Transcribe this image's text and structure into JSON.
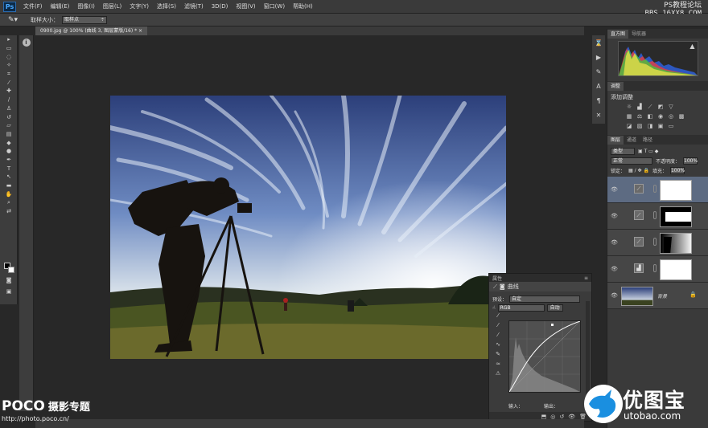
{
  "menubar": {
    "logo": "Ps",
    "items": [
      "文件(F)",
      "编辑(E)",
      "图像(I)",
      "图层(L)",
      "文字(Y)",
      "选择(S)",
      "滤镜(T)",
      "3D(D)",
      "视图(V)",
      "窗口(W)",
      "帮助(H)"
    ]
  },
  "watermark_top": {
    "line1": "PS教程论坛",
    "line2": "BBS.16XX8.COM"
  },
  "options": {
    "size_label": "取样大小：",
    "size_value": "取样点"
  },
  "document": {
    "tab": "0900.jpg @ 100% (曲线 3, 图层蒙版/16) *  ×"
  },
  "right": {
    "histogram_tabs": [
      "直方图",
      "导航器"
    ],
    "adjust_tabs": [
      "调整"
    ],
    "adjust_title": "添加调整",
    "layers_tabs": [
      "图层",
      "通道",
      "路径"
    ],
    "filter_label": "类型",
    "blend_mode": "正常",
    "opacity_label": "不透明度：",
    "opacity_value": "100%",
    "lock_label": "锁定：",
    "fill_label": "填充：",
    "fill_value": "100%",
    "background_layer": "背景"
  },
  "curves": {
    "header": "属性",
    "title": "曲线",
    "preset_label": "预设：",
    "preset_value": "自定",
    "channel_value": "RGB",
    "auto_button": "自动",
    "input_label": "输入：",
    "output_label": "输出："
  },
  "poco": {
    "brand": "POCO",
    "subtitle": "摄影专题",
    "url": "http://photo.poco.cn/"
  },
  "utobao": {
    "cn": "优图宝",
    "url": "utobao.com"
  },
  "colors": {
    "selected_layer": "#5d6b82",
    "panel_bg": "#3a3a3a",
    "canvas_bg": "#282828"
  }
}
